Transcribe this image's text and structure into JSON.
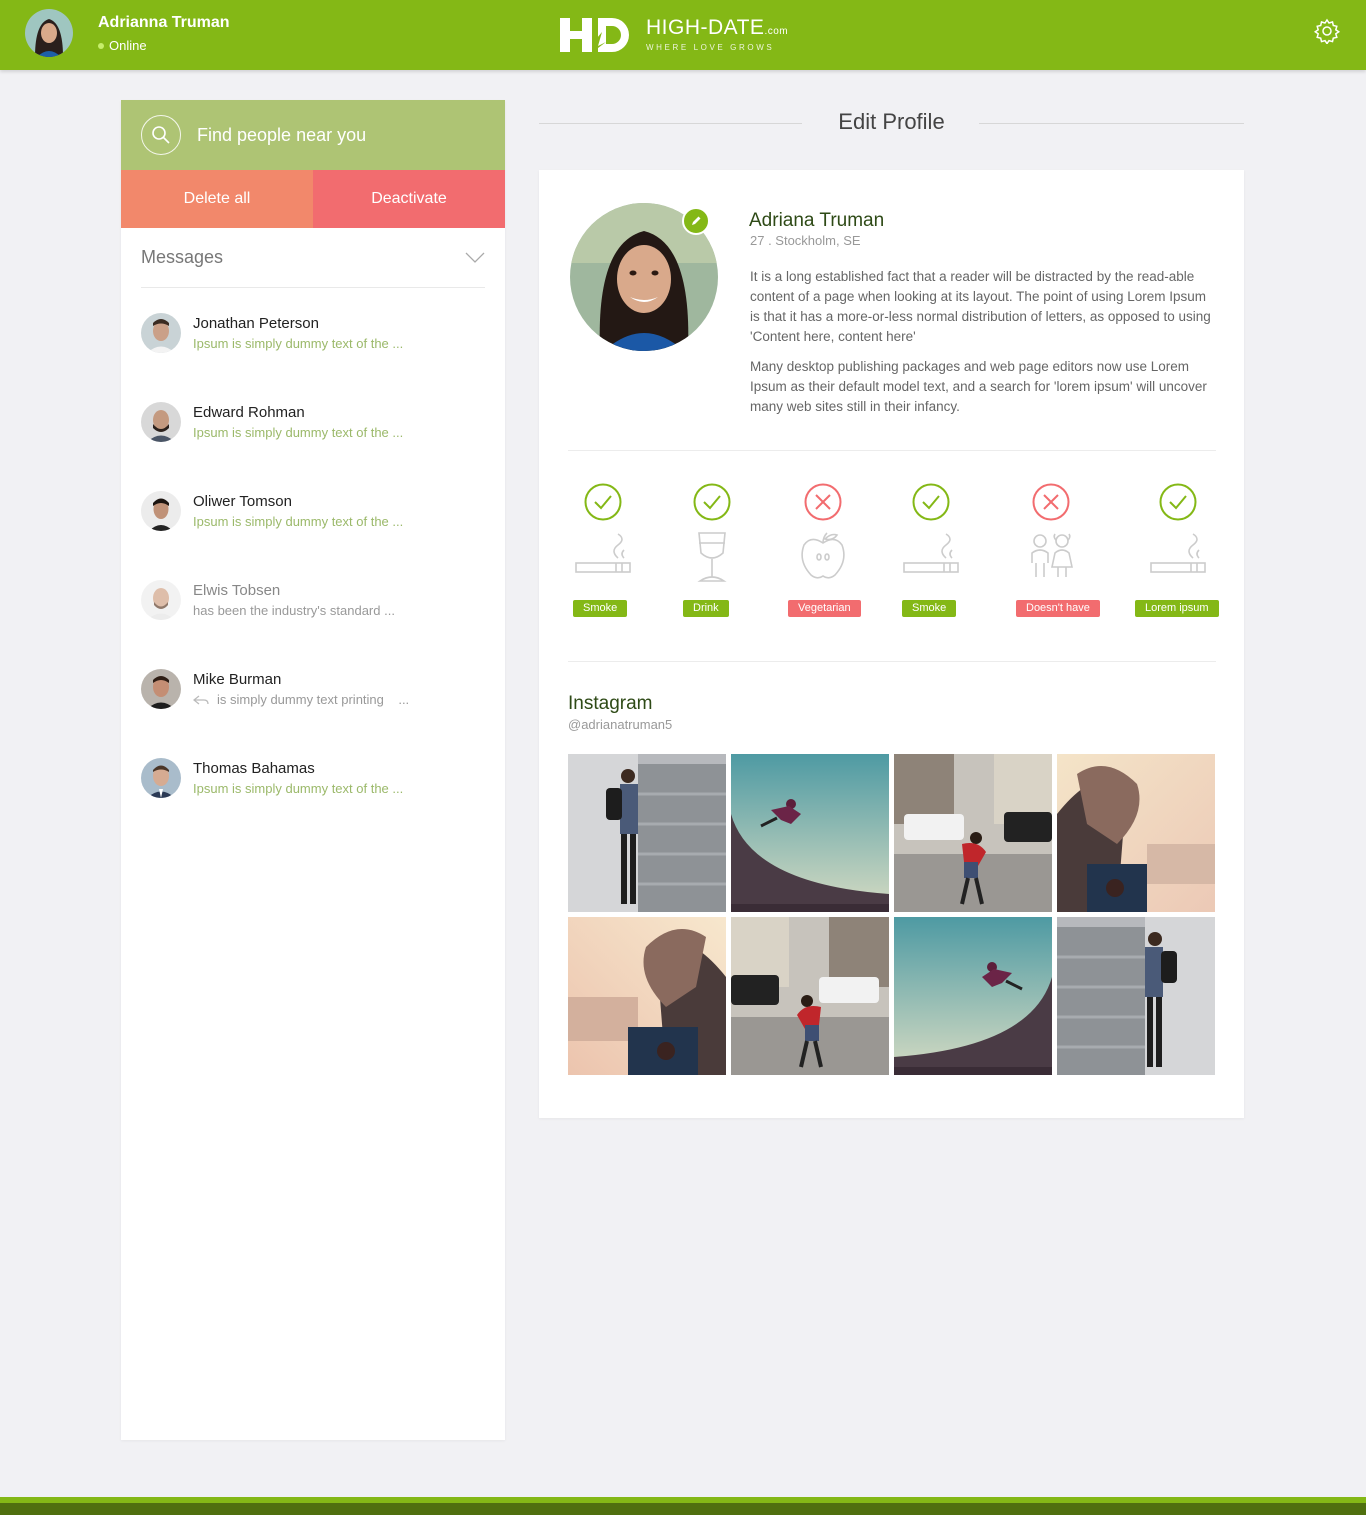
{
  "topbar": {
    "user_name": "Adrianna Truman",
    "status": "Online",
    "logo_name": "HIGH-DATE",
    "logo_suffix": ".com",
    "logo_tagline": "WHERE LOVE GROWS",
    "settings_icon": "gear-icon"
  },
  "sidebar": {
    "search_label": "Find people near you",
    "delete_all_label": "Delete all",
    "deactivate_label": "Deactivate",
    "messages_label": "Messages",
    "messages": [
      {
        "name": "Jonathan Peterson",
        "preview": "Ipsum is simply dummy text of the ...",
        "read": false
      },
      {
        "name": "Edward Rohman",
        "preview": "Ipsum is simply dummy text of the ...",
        "read": false
      },
      {
        "name": "Oliwer Tomson",
        "preview": "Ipsum is simply dummy text of the ...",
        "read": false
      },
      {
        "name": "Elwis Tobsen",
        "preview": "has been the industry's standard ...",
        "read": true
      },
      {
        "name": "Mike Burman",
        "preview": "is simply dummy text printing    ...",
        "read": true,
        "replied": true
      },
      {
        "name": "Thomas Bahamas",
        "preview": "Ipsum is simply dummy text of the ...",
        "read": false
      }
    ]
  },
  "main": {
    "title": "Edit Profile",
    "profile": {
      "name": "Adriana Truman",
      "meta": "27 . Stockholm, SE",
      "bio_1": "It is a long established fact that a reader will be distracted by the read-able content of a page when looking at its layout. The point of using Lorem Ipsum is that it has a more-or-less normal distribution of letters, as opposed to using 'Content here, content here'",
      "bio_2": "Many desktop publishing packages and web page editors now use Lorem Ipsum as their default model text, and a search for 'lorem ipsum' will uncover many web sites still in their infancy."
    },
    "habits": [
      {
        "label": "Smoke",
        "positive": true,
        "icon": "cigarette-icon"
      },
      {
        "label": "Drink",
        "positive": true,
        "icon": "wine-glass-icon"
      },
      {
        "label": "Vegetarian",
        "positive": false,
        "icon": "apple-icon"
      },
      {
        "label": "Smoke",
        "positive": true,
        "icon": "cigarette-icon"
      },
      {
        "label": "Doesn't have",
        "positive": false,
        "icon": "kids-icon"
      },
      {
        "label": "Lorem ipsum",
        "positive": true,
        "icon": "cigarette-icon"
      }
    ],
    "instagram": {
      "title": "Instagram",
      "handle": "@adrianatruman5",
      "photos": [
        "man-by-train",
        "skateboarder-jump",
        "man-red-shirt-street",
        "shoes-car-selfie",
        "shoes-car-selfie",
        "man-red-shirt-street",
        "skateboarder-jump",
        "man-by-train"
      ]
    }
  },
  "colors": {
    "brand_green": "#84b816",
    "search_green": "#aec474",
    "delete_orange": "#f2886b",
    "deactivate_red": "#f26c6f"
  }
}
